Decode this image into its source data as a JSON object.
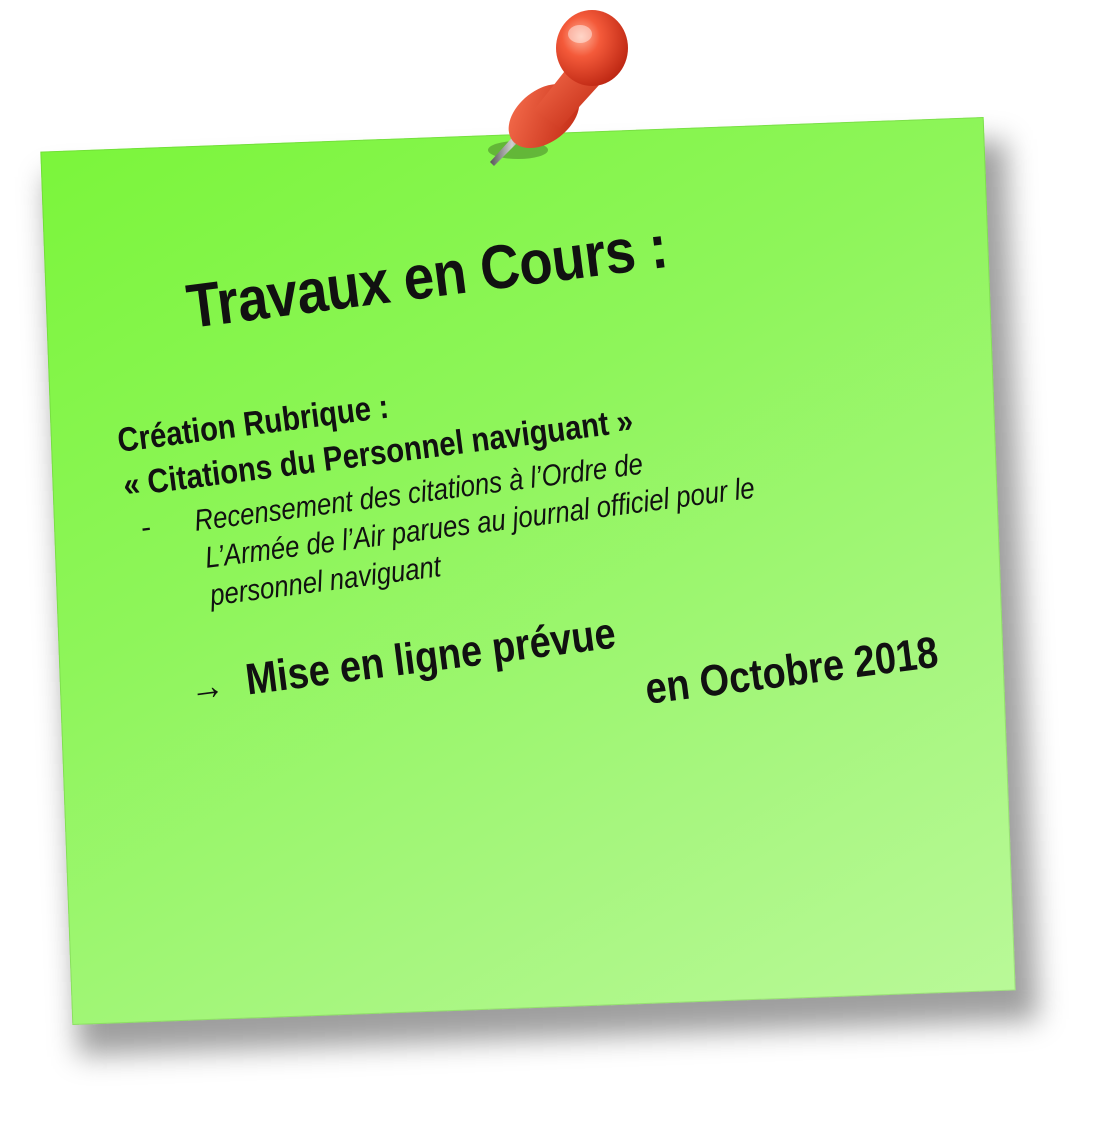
{
  "note": {
    "title": "Travaux en Cours :",
    "rubric": "Création Rubrique :",
    "citations": "« Citations du Personnel naviguant »",
    "bullet_dash": "-",
    "bullet_lines": [
      "Recensement des citations à l’Ordre de",
      "L’Armée de l’Air parues au journal officiel pour le",
      "personnel naviguant"
    ],
    "arrow_icon": "right-arrow-icon",
    "arrow_glyph": "→",
    "mise": "Mise en ligne prévue",
    "date": "en Octobre 2018"
  },
  "colors": {
    "note_light": "#b9f998",
    "note_dark": "#7bf53b",
    "pin": "#e8402a",
    "text": "#111111"
  }
}
